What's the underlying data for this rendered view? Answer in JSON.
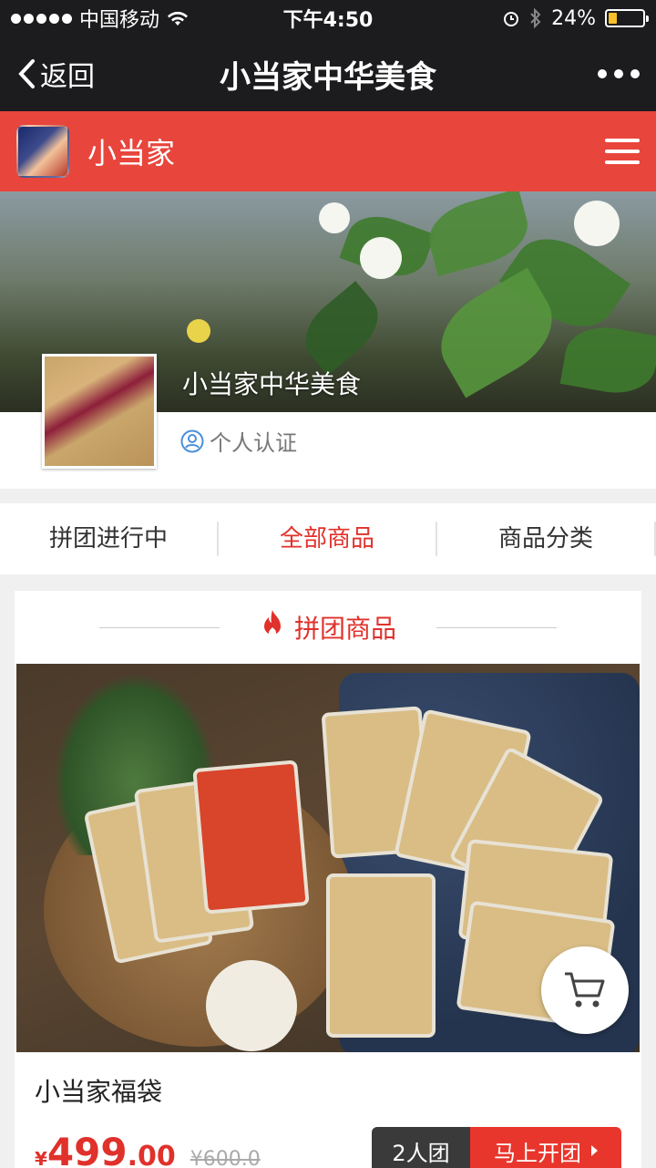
{
  "status_bar": {
    "carrier": "中国移动",
    "time": "下午4:50",
    "battery": "24%",
    "battery_level": 0.24
  },
  "nav": {
    "back_label": "返回",
    "title": "小当家中华美食"
  },
  "shop": {
    "name": "小当家"
  },
  "banner": {
    "store_title": "小当家中华美食",
    "verify_label": "个人认证"
  },
  "tabs": [
    {
      "label": "拼团进行中"
    },
    {
      "label": "全部商品"
    },
    {
      "label": "商品分类"
    }
  ],
  "section": {
    "title": "拼团商品"
  },
  "product": {
    "name": "小当家福袋",
    "price_symbol": "¥",
    "price_int": "499",
    "price_dec": ".00",
    "original_price": "¥600.0",
    "group_size": "2人团",
    "open_group_label": "马上开团"
  },
  "colors": {
    "accent": "#e8453c",
    "nav_bg": "#1c1c1e",
    "price": "#e0312b"
  }
}
